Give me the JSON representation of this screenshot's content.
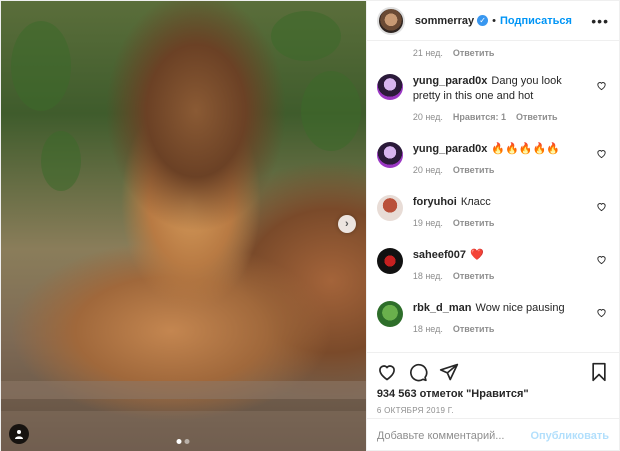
{
  "header": {
    "username": "sommerray",
    "separator": "•",
    "follow_label": "Подписаться",
    "more_label": "•••"
  },
  "comments": {
    "top_meta": {
      "time": "21 нед.",
      "reply_label": "Ответить"
    },
    "items": [
      {
        "username": "yung_parad0x",
        "text": "Dang you look pretty in this one and hot",
        "time": "20 нед.",
        "likes_label": "Нравится: 1",
        "reply_label": "Ответить"
      },
      {
        "username": "yung_parad0x",
        "text": "🔥🔥🔥🔥🔥",
        "time": "20 нед.",
        "likes_label": "",
        "reply_label": "Ответить"
      },
      {
        "username": "foryuhoi",
        "text": "Класс",
        "time": "19 нед.",
        "likes_label": "",
        "reply_label": "Ответить"
      },
      {
        "username": "saheef007",
        "text": "❤️",
        "time": "18 нед.",
        "likes_label": "",
        "reply_label": "Ответить"
      },
      {
        "username": "rbk_d_man",
        "text": "Wow nice pausing",
        "time": "18 нед.",
        "likes_label": "",
        "reply_label": "Ответить"
      }
    ]
  },
  "actions": {
    "likes_text": "934 563 отметок \"Нравится\"",
    "date": "6 ОКТЯБРЯ 2019 Г."
  },
  "add_comment": {
    "placeholder": "Добавьте комментарий...",
    "publish_label": "Опубликовать"
  },
  "media": {
    "carousel_next_label": "›",
    "slides_total": 2,
    "slide_active": 1
  },
  "colors": {
    "accent": "#0095f6",
    "verified": "#3897f0",
    "muted": "#8e8e8e"
  }
}
